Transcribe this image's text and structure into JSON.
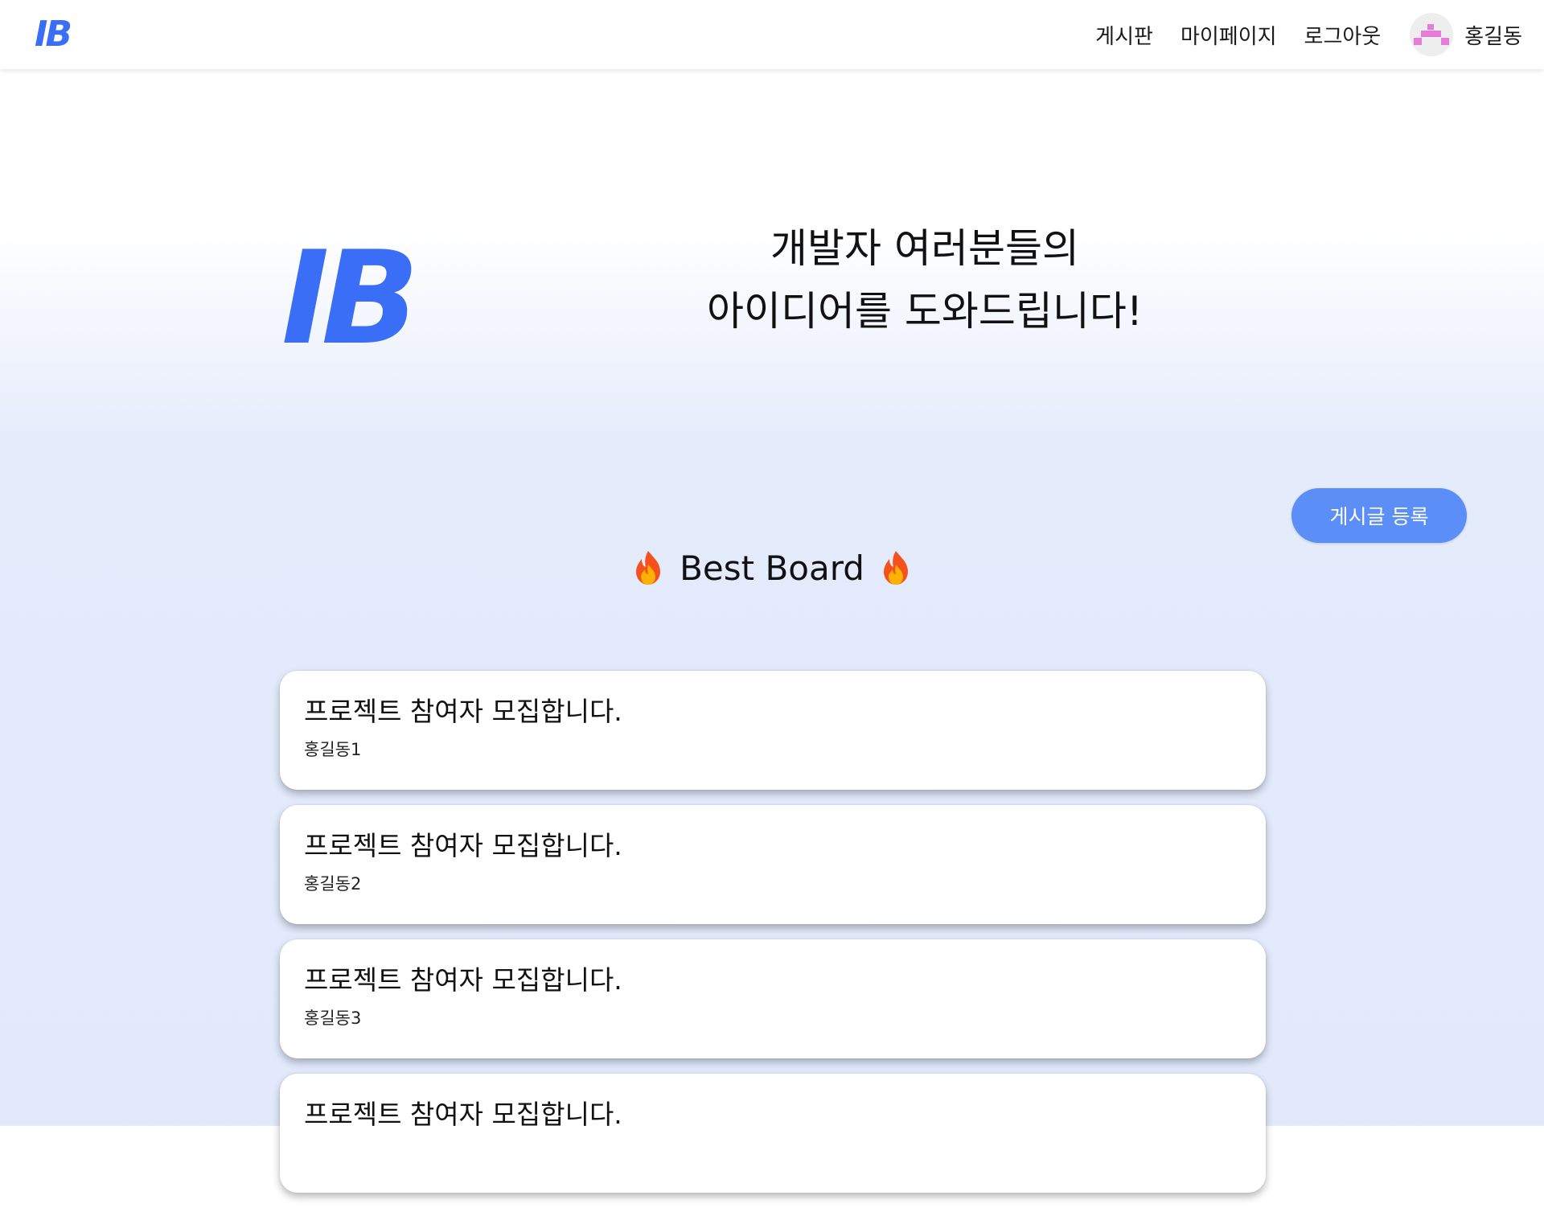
{
  "colors": {
    "brand": "#3b6ef6",
    "button": "#5b8ef7",
    "avatar_pixel": "#e57bdb"
  },
  "header": {
    "logo": "IB",
    "nav": {
      "board": "게시판",
      "mypage": "마이페이지",
      "logout": "로그아웃"
    },
    "user": {
      "avatar_icon": "pixel-avatar-icon",
      "name": "홍길동"
    }
  },
  "hero": {
    "logo": "IB",
    "line1": "개발자 여러분들의",
    "line2": "아이디어를 도와드립니다!"
  },
  "actions": {
    "register_label": "게시글 등록"
  },
  "best_board": {
    "title": "Best Board",
    "icon": "flame-icon",
    "posts": [
      {
        "title": "프로젝트 참여자 모집합니다.",
        "author": "홍길동1"
      },
      {
        "title": "프로젝트 참여자 모집합니다.",
        "author": "홍길동2"
      },
      {
        "title": "프로젝트 참여자 모집합니다.",
        "author": "홍길동3"
      },
      {
        "title": "프로젝트 참여자 모집합니다.",
        "author": ""
      }
    ]
  }
}
